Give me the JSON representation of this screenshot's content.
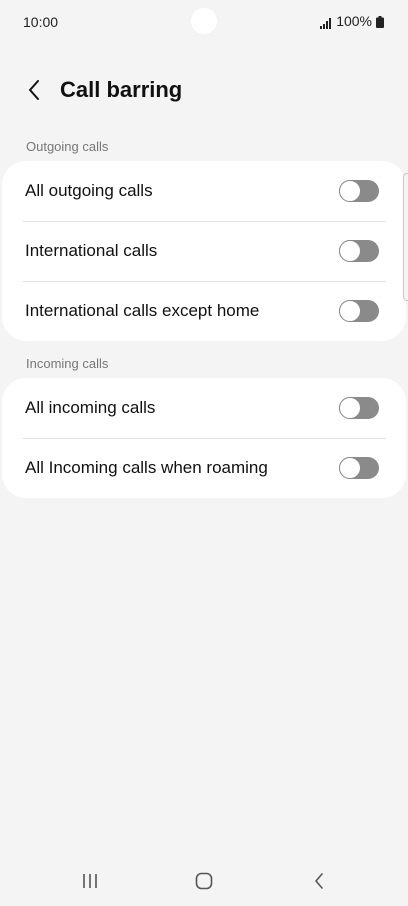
{
  "status_bar": {
    "time": "10:00",
    "battery": "100%",
    "icons": [
      "signal-icon",
      "battery-icon"
    ]
  },
  "header": {
    "title": "Call barring",
    "back_icon": "back-arrow-icon"
  },
  "sections": [
    {
      "label": "Outgoing calls",
      "items": [
        {
          "label": "All outgoing calls",
          "enabled": false
        },
        {
          "label": "International calls",
          "enabled": false
        },
        {
          "label": "International calls except home",
          "enabled": false
        }
      ]
    },
    {
      "label": "Incoming calls",
      "items": [
        {
          "label": "All incoming calls",
          "enabled": false
        },
        {
          "label": "All Incoming calls when roaming",
          "enabled": false
        }
      ]
    }
  ],
  "nav_bar": {
    "icons": [
      "recent-apps-icon",
      "home-icon",
      "back-icon"
    ]
  },
  "colors": {
    "background": "#f4f4f4",
    "card": "#ffffff",
    "toggle_off": "#8a8a8a",
    "section_label": "#777777"
  }
}
